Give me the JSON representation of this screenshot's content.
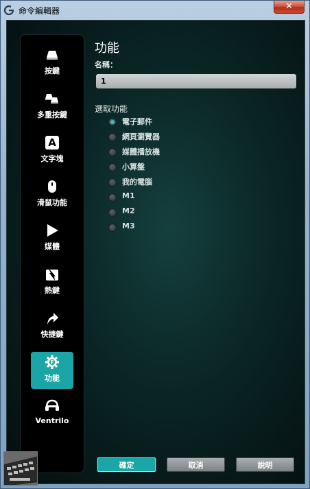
{
  "window": {
    "title": "命令編輯器",
    "close_glyph": "✕"
  },
  "sidebar": {
    "items": [
      {
        "label": "按鍵",
        "icon": "key-icon"
      },
      {
        "label": "多重按鍵",
        "icon": "multikey-icon"
      },
      {
        "label": "文字塊",
        "icon": "text-block-icon"
      },
      {
        "label": "滑鼠功能",
        "icon": "mouse-icon"
      },
      {
        "label": "媒體",
        "icon": "play-icon"
      },
      {
        "label": "熱鍵",
        "icon": "hotkey-icon"
      },
      {
        "label": "快捷鍵",
        "icon": "shortcut-arrow-icon"
      },
      {
        "label": "功能",
        "icon": "function-gear-icon",
        "active": true
      },
      {
        "label": "Ventrilo",
        "icon": "headset-icon"
      }
    ],
    "text_block_glyph": "A"
  },
  "main": {
    "heading": "功能",
    "name_label": "名稱：",
    "name_value": "1",
    "section_label": "選取功能",
    "options": [
      {
        "label": "電子郵件",
        "selected": true
      },
      {
        "label": "網頁瀏覽器",
        "selected": false
      },
      {
        "label": "媒體播放機",
        "selected": false
      },
      {
        "label": "小算盤",
        "selected": false
      },
      {
        "label": "我的電腦",
        "selected": false
      },
      {
        "label": "M1",
        "selected": false
      },
      {
        "label": "M2",
        "selected": false
      },
      {
        "label": "M3",
        "selected": false
      }
    ]
  },
  "buttons": {
    "ok": "確定",
    "cancel": "取消",
    "help": "說明"
  },
  "colors": {
    "accent": "#1aa6a6",
    "sidebar_bg": "#000000",
    "panel_bg": "#0a2525"
  }
}
